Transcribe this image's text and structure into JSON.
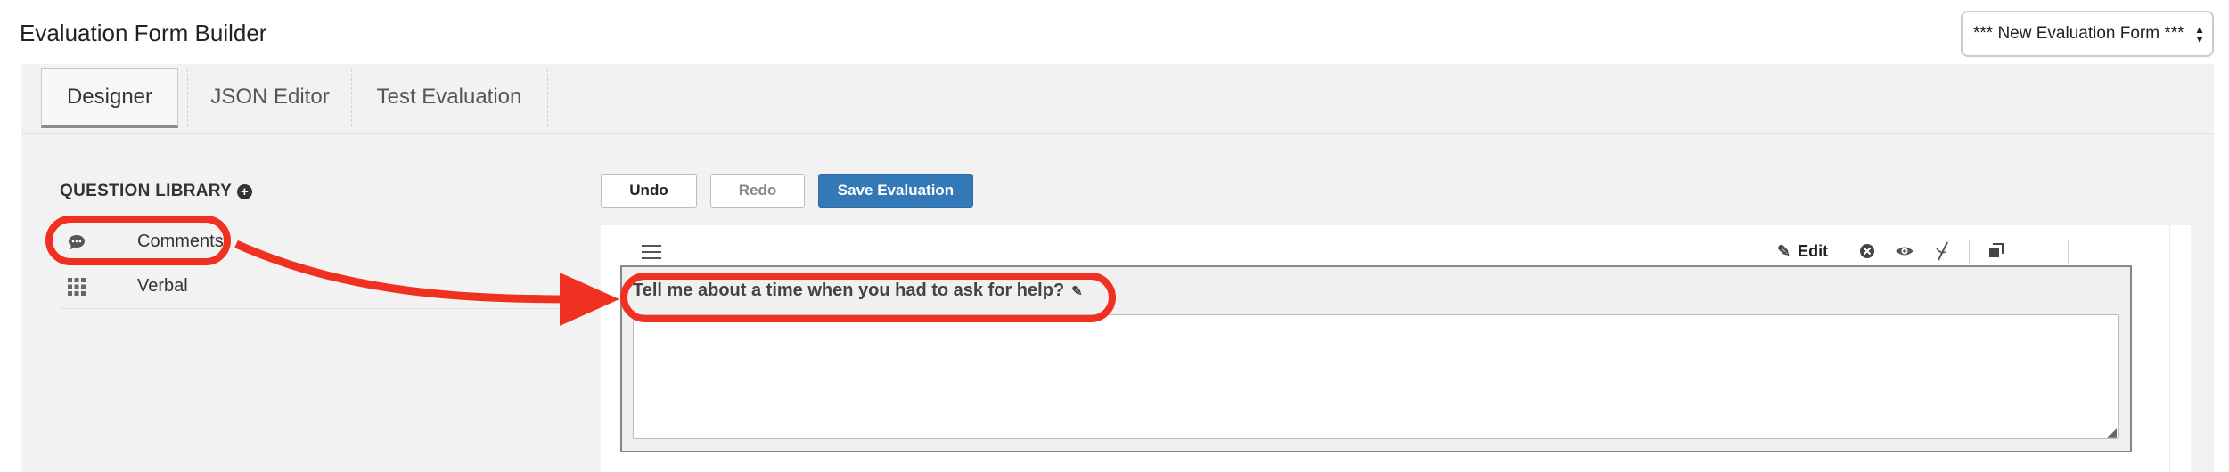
{
  "header": {
    "title": "Evaluation Form Builder",
    "form_select_value": "*** New Evaluation Form ***"
  },
  "tabs": [
    {
      "label": "Designer",
      "active": true
    },
    {
      "label": "JSON Editor",
      "active": false
    },
    {
      "label": "Test Evaluation",
      "active": false
    }
  ],
  "library": {
    "title": "QUESTION LIBRARY",
    "items": [
      {
        "label": "Comments",
        "icon": "speech-bubble-icon"
      },
      {
        "label": "Verbal",
        "icon": "grid-icon"
      }
    ]
  },
  "actions": {
    "undo_label": "Undo",
    "redo_label": "Redo",
    "save_label": "Save Evaluation"
  },
  "question": {
    "toolbar": {
      "edit_label": "Edit"
    },
    "text": "Tell me about a time when you had to ask for help?",
    "answer_value": ""
  },
  "colors": {
    "accent": "#3379b7",
    "annotation": "#f03020"
  }
}
